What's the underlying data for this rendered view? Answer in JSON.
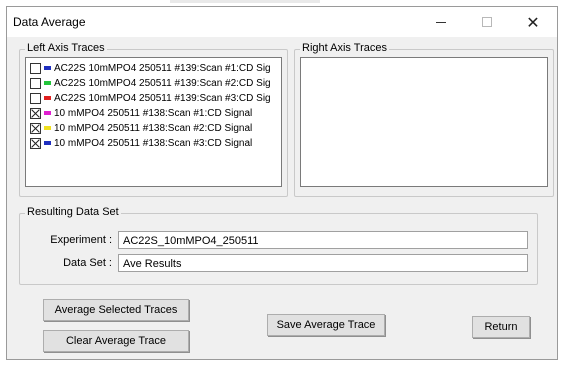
{
  "window": {
    "title": "Data Average",
    "controls": {
      "minimize": "minimize-icon",
      "maximize": "maximize-icon",
      "close": "close-icon"
    }
  },
  "left_axis": {
    "label": "Left Axis Traces",
    "traces": [
      {
        "label": "AC22S 10mMPO4 250511 #139:Scan #1:CD Sig",
        "checked": false,
        "color": "#1f2fbf"
      },
      {
        "label": "AC22S 10mMPO4 250511 #139:Scan #2:CD Sig",
        "checked": false,
        "color": "#22c43a"
      },
      {
        "label": "AC22S 10mMPO4 250511 #139:Scan #3:CD Sig",
        "checked": false,
        "color": "#e02020"
      },
      {
        "label": "10 mMPO4 250511 #138:Scan #1:CD Signal",
        "checked": true,
        "color": "#e020d0"
      },
      {
        "label": "10 mMPO4 250511 #138:Scan #2:CD Signal",
        "checked": true,
        "color": "#f0e020"
      },
      {
        "label": "10 mMPO4 250511 #138:Scan #3:CD Signal",
        "checked": true,
        "color": "#1f2fbf"
      }
    ]
  },
  "right_axis": {
    "label": "Right Axis Traces"
  },
  "result": {
    "label": "Resulting Data Set",
    "experiment_label": "Experiment :",
    "experiment_value": "AC22S_10mMPO4_250511",
    "dataset_label": "Data Set :",
    "dataset_value": "Ave Results"
  },
  "buttons": {
    "average": "Average Selected Traces",
    "clear": "Clear Average Trace",
    "save": "Save Average Trace",
    "return": "Return"
  }
}
